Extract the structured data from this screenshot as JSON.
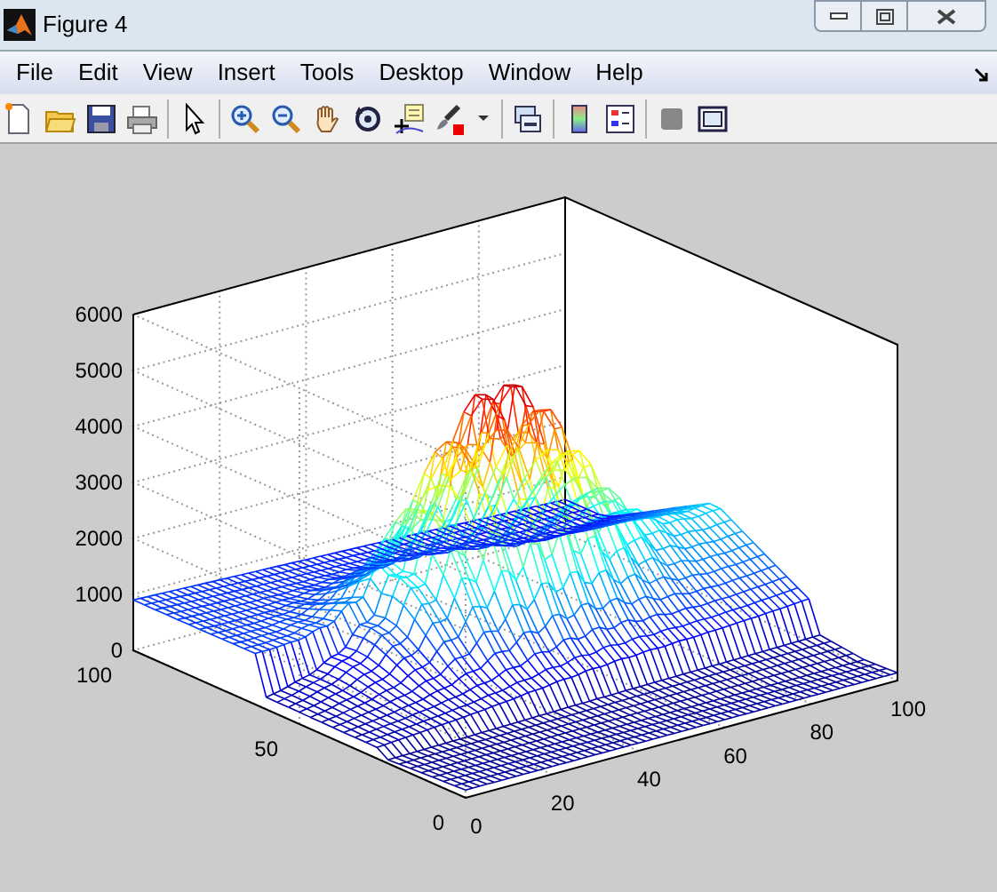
{
  "window": {
    "title": "Figure 4"
  },
  "menu_bar": {
    "items": [
      "File",
      "Edit",
      "View",
      "Insert",
      "Tools",
      "Desktop",
      "Window",
      "Help"
    ]
  },
  "axes": {
    "z_ticks": [
      "6000",
      "5000",
      "4000",
      "3000",
      "2000",
      "1000",
      "0"
    ],
    "x_ticks": [
      "0",
      "20",
      "40",
      "60",
      "80",
      "100"
    ],
    "y_ticks": [
      "0",
      "50",
      "100"
    ]
  }
}
